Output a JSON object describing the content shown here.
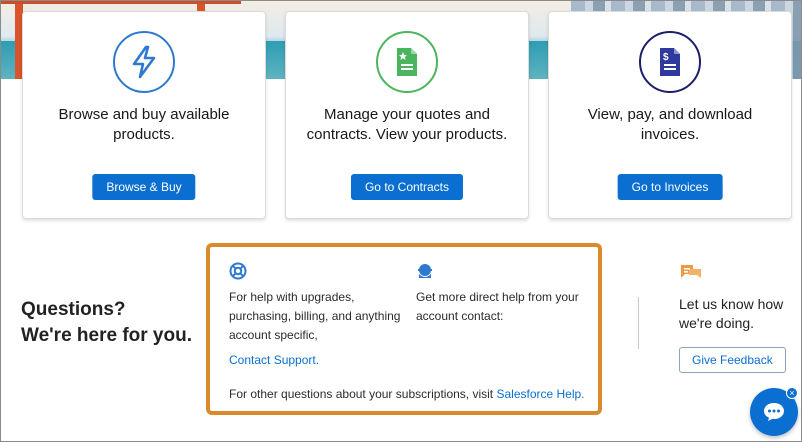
{
  "cards": [
    {
      "description": "Browse and buy available products.",
      "button": "Browse & Buy",
      "icon": "lightning-bolt-icon",
      "color": "#2e7ad1"
    },
    {
      "description": "Manage your quotes and contracts. View your products.",
      "button": "Go to Contracts",
      "icon": "document-star-icon",
      "color": "#4bb55e"
    },
    {
      "description": "View, pay, and download invoices.",
      "button": "Go to Invoices",
      "icon": "invoice-dollar-icon",
      "color": "#1b1f6b"
    }
  ],
  "questions": {
    "line1": "Questions?",
    "line2": "We're here for you."
  },
  "help": {
    "col1_text": "For help with upgrades, purchasing, billing, and anything account specific,",
    "col1_link": "Contact Support.",
    "col2_text": "Get more direct help from your account contact:",
    "footer_text": "For other questions about your subscriptions, visit ",
    "footer_link": "Salesforce Help."
  },
  "feedback": {
    "text": "Let us know how we're doing.",
    "button": "Give Feedback"
  },
  "chat": {
    "close_symbol": "×"
  },
  "colors": {
    "primary": "#0b6fd1",
    "highlight_border": "#d98a2b"
  }
}
